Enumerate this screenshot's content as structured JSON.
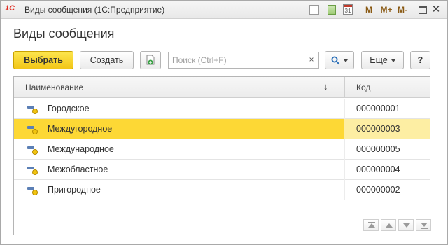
{
  "window": {
    "app_logo": "1С",
    "title": "Виды сообщения  (1С:Предприятие)",
    "toolbar": {
      "calendar_day": "31",
      "m": "M",
      "m_plus": "M+",
      "m_minus": "M-",
      "close": "✕"
    }
  },
  "page": {
    "title": "Виды сообщения"
  },
  "commands": {
    "select_label": "Выбрать",
    "create_label": "Создать",
    "search_placeholder": "Поиск (Ctrl+F)",
    "search_clear": "×",
    "more_label": "Еще",
    "help_label": "?"
  },
  "grid": {
    "columns": {
      "name": "Наименование",
      "code": "Код",
      "sort_indicator": "↓"
    },
    "rows": [
      {
        "name": "Городское",
        "code": "000000001",
        "selected": false
      },
      {
        "name": "Междугородное",
        "code": "000000003",
        "selected": true
      },
      {
        "name": "Международное",
        "code": "000000005",
        "selected": false
      },
      {
        "name": "Межобластное",
        "code": "000000004",
        "selected": false
      },
      {
        "name": "Пригородное",
        "code": "000000002",
        "selected": false
      }
    ]
  },
  "colors": {
    "accent": "#fdd835",
    "select_button": "#f2c618",
    "logo_red": "#e0261b"
  }
}
